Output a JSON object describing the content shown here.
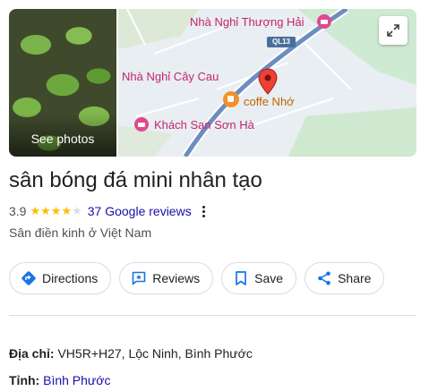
{
  "media": {
    "see_photos_label": "See photos"
  },
  "map": {
    "labels": {
      "hotel_thuong_hai": "Nhà Nghỉ Thượng Hải",
      "hotel_cay_cau": "Nhà Nghỉ Cây Cau",
      "hotel_son_ha": "Khách Sạn Sơn Hà",
      "coffee_nho": "coffe Nhớ"
    },
    "road_shield": "QL13",
    "expand_icon": "expand-icon",
    "colors": {
      "poi_label": "#c5246f",
      "cafe_label": "#c26401",
      "pin": "#ea4335",
      "road": "#4a6f9c"
    }
  },
  "place": {
    "name": "sân bóng đá mini nhân tạo",
    "rating": "3.9",
    "rating_value": 3.9,
    "stars_filled": 4,
    "stars_total": 5,
    "reviews_label": "37 Google reviews",
    "category": "Sân điền kinh ở Việt Nam",
    "star_color": "#fbbc04"
  },
  "actions": [
    {
      "label": "Directions",
      "icon": "directions-icon"
    },
    {
      "label": "Reviews",
      "icon": "reviews-icon"
    },
    {
      "label": "Save",
      "icon": "bookmark-icon"
    },
    {
      "label": "Share",
      "icon": "share-icon"
    }
  ],
  "details": {
    "address_label": "Địa chỉ",
    "address_value": "VH5R+H27, Lộc Ninh, Bình Phước",
    "province_label": "Tỉnh",
    "province_value": "Bình Phước"
  }
}
